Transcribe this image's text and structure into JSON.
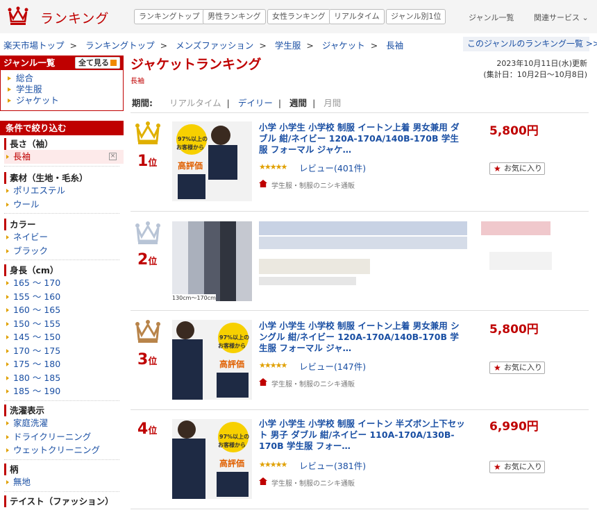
{
  "header": {
    "logo_text": "ランキング",
    "nav": [
      "ランキングトップ",
      "男性ランキング",
      "女性ランキング",
      "リアルタイム",
      "ジャンル別1位"
    ],
    "links": [
      "ジャンル一覧",
      "関連サービス ⌄"
    ]
  },
  "breadcrumb": [
    "楽天市場トップ",
    "ランキングトップ",
    "メンズファッション",
    "学生服",
    "ジャケット",
    "長袖"
  ],
  "genre_list_link": "このジャンルのランキング一覧 >>",
  "sidebar": {
    "genre_title": "ジャンル一覧",
    "all_button": "全て見る",
    "genres": [
      "総合",
      "学生服",
      "ジャケット"
    ],
    "filter_title": "条件で絞り込む",
    "groups": [
      {
        "title": "長さ（袖）",
        "items": [
          "長袖"
        ]
      },
      {
        "title": "素材（生地・毛糸）",
        "items": [
          "ポリエステル",
          "ウール"
        ]
      },
      {
        "title": "カラー",
        "items": [
          "ネイビー",
          "ブラック"
        ]
      },
      {
        "title": "身長（cm）",
        "items": [
          "165 ～ 170",
          "155 ～ 160",
          "160 ～ 165",
          "150 ～ 155",
          "145 ～ 150",
          "170 ～ 175",
          "175 ～ 180",
          "180 ～ 185",
          "185 ～ 190"
        ]
      },
      {
        "title": "洗濯表示",
        "items": [
          "家庭洗濯",
          "ドライクリーニング",
          "ウェットクリーニング"
        ]
      },
      {
        "title": "柄",
        "items": [
          "無地"
        ]
      },
      {
        "title": "テイスト（ファッション）",
        "items": []
      }
    ]
  },
  "main": {
    "title": "ジャケットランキング",
    "subtitle": "長袖",
    "updated": "2023年10月11日(水)更新",
    "period_range": "(集計日：10月2日～10月8日)",
    "period_label": "期間:",
    "periods": [
      "リアルタイム",
      "デイリー",
      "週間",
      "月間"
    ]
  },
  "items": [
    {
      "rank": "1",
      "rank_suffix": "位",
      "title": "小学 小学生 小学校 制服 イートン上着 男女兼用 ダブル 紺/ネイビー 120A-170A/140B-170B 学生服 フォーマル ジャケ…",
      "review": "レビュー(401件)",
      "shop": "学生服・制服のニシキ通販",
      "price": "5,800円",
      "fav": "お気に入り",
      "thumb_text": [
        "97%以上の",
        "お客様から",
        "高評価"
      ]
    },
    {
      "rank": "2",
      "rank_suffix": "位",
      "title": "",
      "review": "",
      "shop": "",
      "price": "",
      "fav": "",
      "thumb_text": [
        "130cm～170cm"
      ]
    },
    {
      "rank": "3",
      "rank_suffix": "位",
      "title": "小学 小学生 小学校 制服 イートン上着 男女兼用 シングル 紺/ネイビー 120A-170A/140B-170B 学生服 フォーマル ジャ…",
      "review": "レビュー(147件)",
      "shop": "学生服・制服のニシキ通販",
      "price": "5,800円",
      "fav": "お気に入り",
      "thumb_text": [
        "97%以上の",
        "お客様から",
        "高評価"
      ]
    },
    {
      "rank": "4",
      "rank_suffix": "位",
      "title": "小学 小学生 小学校 制服 イートン 半ズボン上下セット 男子 ダブル 紺/ネイビー 110A-170A/130B-170B 学生服 フォー…",
      "review": "レビュー(381件)",
      "shop": "学生服・制服のニシキ通販",
      "price": "6,990円",
      "fav": "お気に入り",
      "thumb_text": [
        "97%以上の",
        "お客様から",
        "高評価"
      ]
    }
  ],
  "colors": {
    "accent": "#bf0000",
    "link": "#1a4fa3",
    "gold": "#e0a000"
  }
}
